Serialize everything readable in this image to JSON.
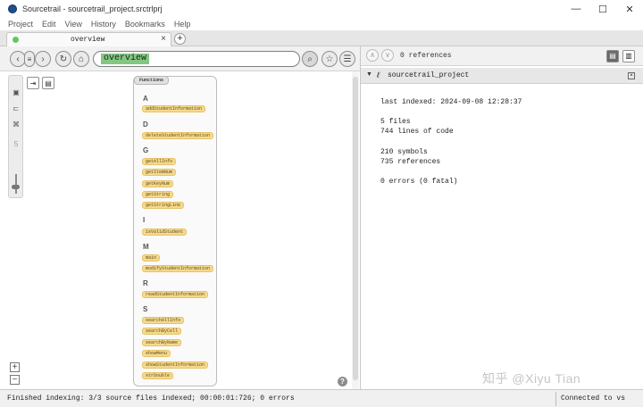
{
  "window": {
    "title": "Sourcetrail - sourcetrail_project.srctrlprj",
    "controls": [
      "—",
      "☐",
      "✕"
    ]
  },
  "menu": [
    "Project",
    "Edit",
    "View",
    "History",
    "Bookmarks",
    "Help"
  ],
  "tab": {
    "label": "overview",
    "close": "×",
    "add": "+"
  },
  "nav": {
    "back": "‹",
    "forward": "›",
    "history": "≡",
    "refresh": "↻",
    "home": "⌂",
    "search_value": "overview",
    "search_icon": "⌕",
    "bookmark_icon": "☆",
    "bookmarks_list": "☰"
  },
  "graph": {
    "view_toggle_icons": [
      "⇥",
      "▤"
    ],
    "zoom_in": "+",
    "zoom_out": "−",
    "help": "?",
    "box_title": "Functions",
    "groups": [
      {
        "letter": "A",
        "functions": [
          "addStudentInformation"
        ]
      },
      {
        "letter": "D",
        "functions": [
          "deleteStudentInformation"
        ]
      },
      {
        "letter": "G",
        "functions": [
          "getAllInfo",
          "getItemNum",
          "getKeyNum",
          "getString",
          "getStringLine"
        ]
      },
      {
        "letter": "I",
        "functions": [
          "isValidStudent"
        ]
      },
      {
        "letter": "M",
        "functions": [
          "main",
          "modifyStudentInformation"
        ]
      },
      {
        "letter": "R",
        "functions": [
          "readStudentInformation"
        ]
      },
      {
        "letter": "S",
        "functions": [
          "searchAllInfo",
          "searchByCell",
          "searchByName",
          "showMenu",
          "showStudentInformation",
          "strDouble"
        ]
      }
    ]
  },
  "references": {
    "prev": "∧",
    "next": "∨",
    "count_text": "0 references",
    "toggles": [
      "▤",
      "▥"
    ]
  },
  "project": {
    "caret": "▼",
    "icon": "ℓ",
    "name": "sourcetrail_project",
    "close": "×",
    "lines": [
      "last indexed: 2024-09-08 12:28:37",
      "5 files",
      "744 lines of code",
      "210 symbols",
      "735 references",
      "0 errors (0 fatal)"
    ]
  },
  "status": {
    "left": "Finished indexing: 3/3 source files indexed; 00:00:01:726; 0 errors",
    "right": "Connected to vs"
  },
  "watermark": "知乎 @Xiyu Tian",
  "colors": {
    "search_highlight": "#82c882",
    "function_pill": "#f6d98a",
    "tab_status_dot": "#61c861"
  }
}
